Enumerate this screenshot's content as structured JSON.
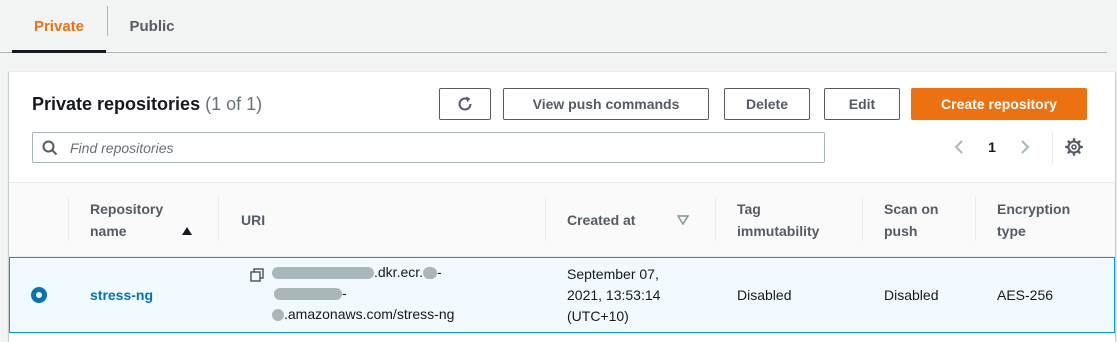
{
  "tabs": [
    {
      "label": "Private",
      "active": true
    },
    {
      "label": "Public",
      "active": false
    }
  ],
  "panel": {
    "title": "Private repositories",
    "count": "(1 of 1)"
  },
  "toolbar": {
    "refresh_icon": "refresh-icon",
    "view_push_label": "View push commands",
    "delete_label": "Delete",
    "edit_label": "Edit",
    "create_label": "Create repository"
  },
  "search": {
    "placeholder": "Find repositories",
    "value": ""
  },
  "pagination": {
    "current_page": "1"
  },
  "table": {
    "headers": {
      "repository_name_line1": "Repository",
      "repository_name_line2": "name",
      "uri": "URI",
      "created_at": "Created at",
      "tag_immutability_line1": "Tag",
      "tag_immutability_line2": "immutability",
      "scan_on_push_line1": "Scan on",
      "scan_on_push_line2": "push",
      "encryption_type_line1": "Encryption",
      "encryption_type_line2": "type"
    },
    "rows": [
      {
        "selected": true,
        "repository_name": "stress-ng",
        "uri_part1": ".dkr.ecr.",
        "uri_part2": "-",
        "uri_part3": "-",
        "uri_part4": ".amazonaws.com/stress-ng",
        "created_at_line1": "September 07,",
        "created_at_line2": "2021, 13:53:14",
        "created_at_line3": "(UTC+10)",
        "tag_immutability": "Disabled",
        "scan_on_push": "Disabled",
        "encryption_type": "AES-256"
      }
    ]
  },
  "colors": {
    "accent": "#ec7211",
    "link": "#0073bb",
    "selected_row_bg": "#f1faff",
    "selected_row_border": "#00a1c9"
  }
}
